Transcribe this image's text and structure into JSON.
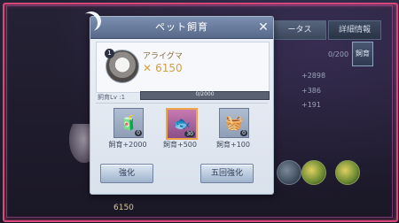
{
  "background": {
    "tabs": [
      "ータス",
      "詳細情報"
    ],
    "side_icon_label": "飼育",
    "ratio": "0/200",
    "stats": [
      "+2898",
      "+386",
      "+191"
    ],
    "bottom_coin": "6150"
  },
  "dialog": {
    "title": "ペット飼育",
    "close_icon": "close-icon",
    "pet": {
      "name": "アライグマ",
      "level_badge": "1",
      "currency": "6150"
    },
    "feed_level_label": "飼育Lv :1",
    "progress_text": "0/2000",
    "progress_value": 0,
    "items": [
      {
        "icon": "food-bag-icon",
        "count": "0",
        "label": "飼育+2000"
      },
      {
        "icon": "fish-treat-icon",
        "count": "30",
        "label": "飼育+500"
      },
      {
        "icon": "snack-basket-icon",
        "count": "0",
        "label": "飼育+100"
      }
    ],
    "buttons": {
      "strengthen": "強化",
      "strengthen_five": "五回強化"
    }
  },
  "colors": {
    "frame_border": "#d8487a",
    "title_bar": "#6b7fa0",
    "currency": "#d1a04a",
    "progress_fill": "#9fd06c",
    "selected_item": "#f0a44a"
  }
}
